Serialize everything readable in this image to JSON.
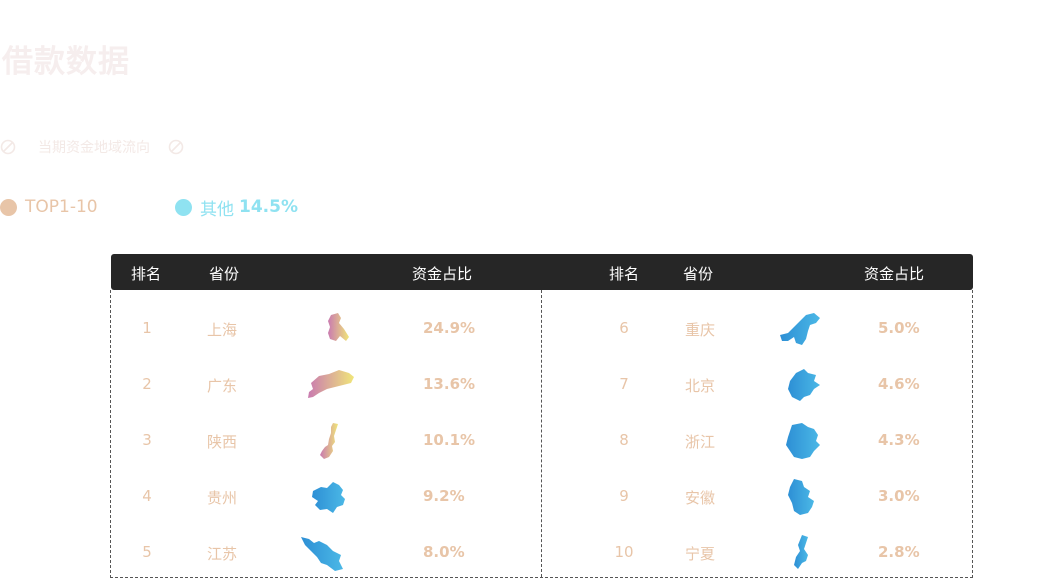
{
  "page": {
    "title": "借款数据"
  },
  "subtitle": {
    "text": "当期资金地域流向"
  },
  "legend": {
    "top_label": "TOP1-10",
    "other_label": "其他",
    "other_value": "14.5%",
    "colors": {
      "top": "#e8c5a8",
      "other": "#8fe2f1"
    }
  },
  "table": {
    "headers": {
      "left": {
        "rank": "排名",
        "province": "省份",
        "share": "资金占比"
      },
      "right": {
        "rank": "排名",
        "province": "省份",
        "share": "资金占比"
      }
    },
    "left_rows": [
      {
        "rank": "1",
        "province": "上海",
        "share": "24.9%",
        "icon": "shanghai-map-icon"
      },
      {
        "rank": "2",
        "province": "广东",
        "share": "13.6%",
        "icon": "guangdong-map-icon"
      },
      {
        "rank": "3",
        "province": "陕西",
        "share": "10.1%",
        "icon": "shaanxi-map-icon"
      },
      {
        "rank": "4",
        "province": "贵州",
        "share": "9.2%",
        "icon": "guizhou-map-icon"
      },
      {
        "rank": "5",
        "province": "江苏",
        "share": "8.0%",
        "icon": "jiangsu-map-icon"
      }
    ],
    "right_rows": [
      {
        "rank": "6",
        "province": "重庆",
        "share": "5.0%",
        "icon": "chongqing-map-icon"
      },
      {
        "rank": "7",
        "province": "北京",
        "share": "4.6%",
        "icon": "beijing-map-icon"
      },
      {
        "rank": "8",
        "province": "浙江",
        "share": "4.3%",
        "icon": "zhejiang-map-icon"
      },
      {
        "rank": "9",
        "province": "安徽",
        "share": "3.0%",
        "icon": "anhui-map-icon"
      },
      {
        "rank": "10",
        "province": "宁夏",
        "share": "2.8%",
        "icon": "ningxia-map-icon"
      }
    ]
  }
}
